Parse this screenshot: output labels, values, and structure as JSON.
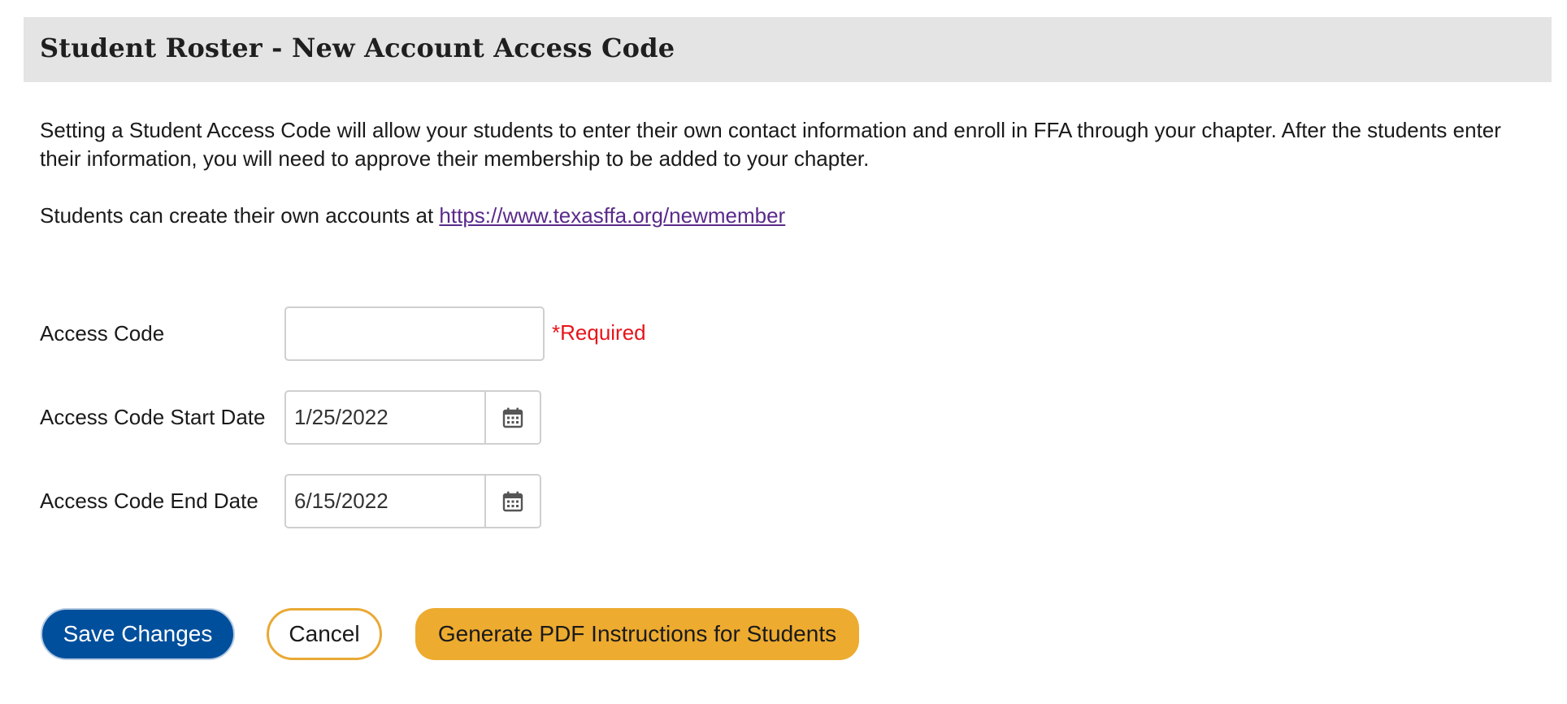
{
  "header": {
    "title": "Student Roster - New Account Access Code"
  },
  "intro": {
    "text": "Setting a Student Access Code will allow your students to enter their own contact information and enroll in FFA through your chapter. After the students enter their information, you will need to approve their membership to be added to your chapter."
  },
  "signup": {
    "prefix": "Students can create their own accounts at ",
    "link_text": "https://www.texasffa.org/newmember"
  },
  "form": {
    "access_code": {
      "label": "Access Code",
      "value": "",
      "required_text": "*Required"
    },
    "start_date": {
      "label": "Access Code Start Date",
      "value": "1/25/2022"
    },
    "end_date": {
      "label": "Access Code End Date",
      "value": "6/15/2022"
    }
  },
  "buttons": {
    "save": "Save Changes",
    "cancel": "Cancel",
    "pdf": "Generate PDF Instructions for Students"
  },
  "colors": {
    "primary_blue": "#004f9c",
    "accent_gold": "#edab30",
    "required_red": "#e8141b",
    "link_purple": "#5a2a8a",
    "header_gray": "#e4e4e4"
  },
  "icons": {
    "calendar": "calendar-icon"
  }
}
